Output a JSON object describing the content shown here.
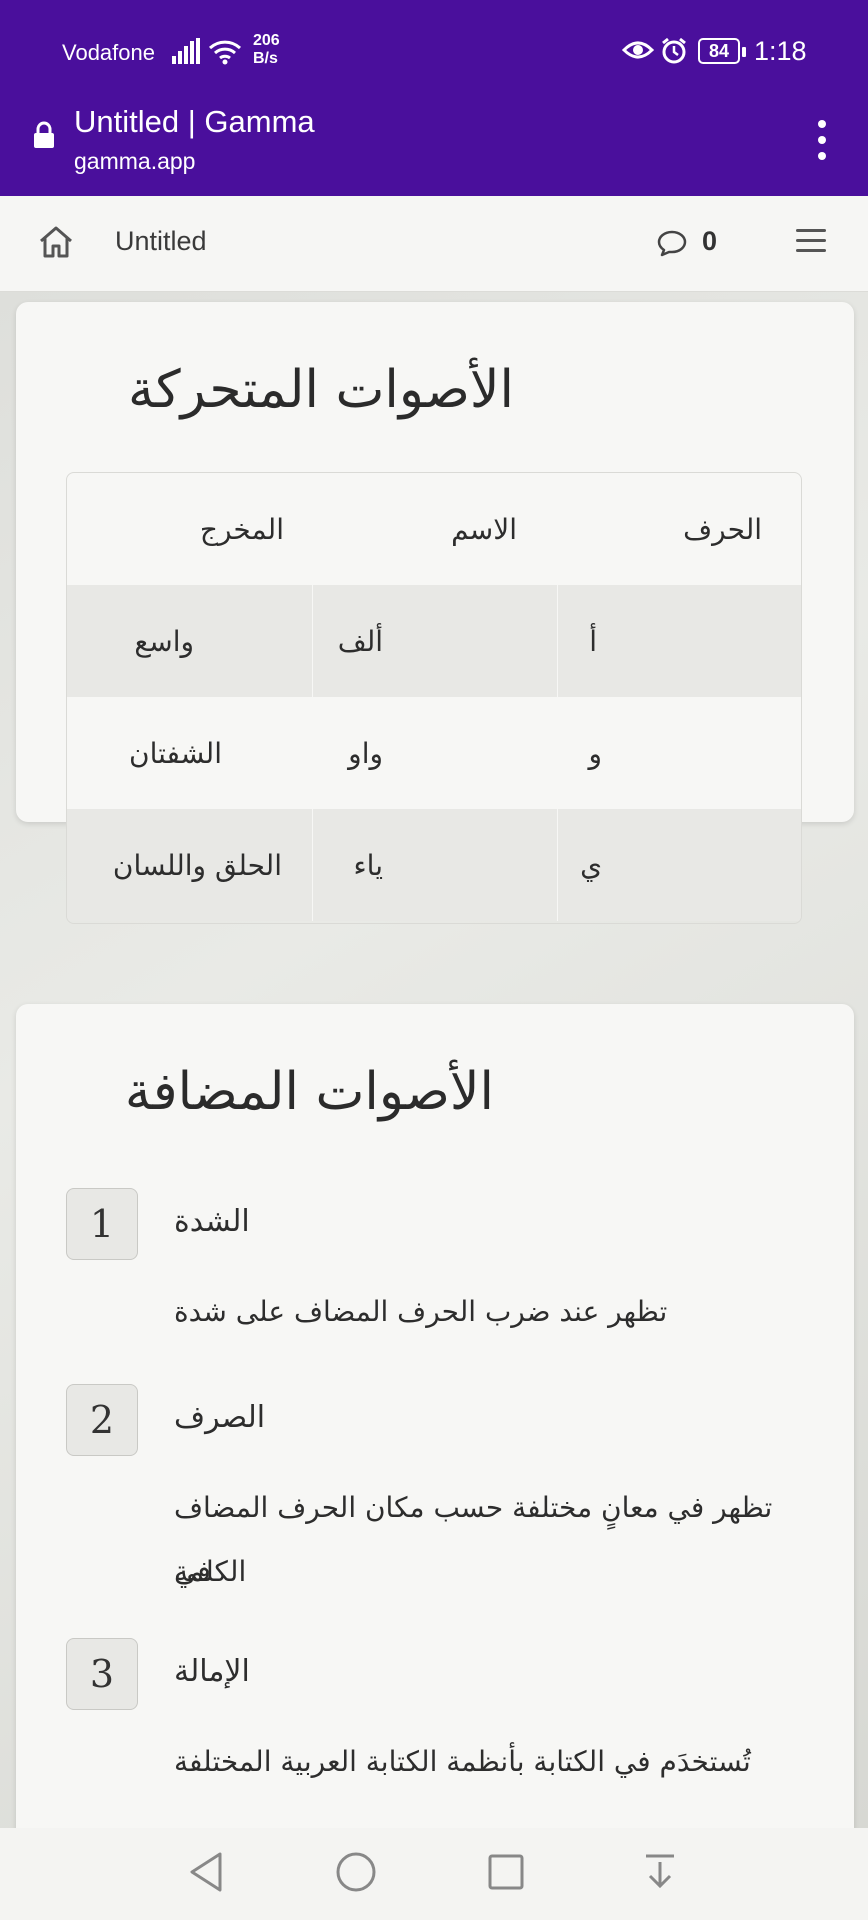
{
  "status_bar": {
    "carrier": "Vodafone",
    "net_speed_value": "206",
    "net_speed_unit": "B/s",
    "battery": "84",
    "time": "1:18"
  },
  "browser": {
    "page_title": "Untitled | Gamma",
    "url": "gamma.app"
  },
  "toolbar": {
    "doc_title": "Untitled",
    "comment_count": "0"
  },
  "card1": {
    "heading": "الأصوات المتحركة",
    "table": {
      "headers": [
        "الحرف",
        "الاسم",
        "المخرج"
      ],
      "rows": [
        [
          "أ",
          "ألف",
          "واسع"
        ],
        [
          "و",
          "واو",
          "الشفتان"
        ],
        [
          "ي",
          "ياء",
          "الحلق واللسان"
        ]
      ]
    }
  },
  "card2": {
    "heading": "الأصوات المضافة",
    "items": [
      {
        "number": "1",
        "title": "الشدة",
        "desc": "تظهر عند ضرب الحرف المضاف على شدة"
      },
      {
        "number": "2",
        "title": "الصرف",
        "desc_line1": "تظهر في معانٍ مختلفة حسب مكان الحرف المضاف في",
        "desc_line2": "الكلمة"
      },
      {
        "number": "3",
        "title": "الإمالة",
        "desc": "تُستخدَم في الكتابة بأنظمة الكتابة العربية المختلفة"
      }
    ]
  },
  "icons": {
    "lock": "lock-icon",
    "home": "home-icon",
    "comment": "comment-icon",
    "menu": "hamburger-menu-icon",
    "kebab": "more-vert-icon"
  },
  "colors": {
    "brand_bar": "#4a0f9c",
    "card_bg": "#f7f7f5",
    "table_shade": "#e8e8e5"
  }
}
